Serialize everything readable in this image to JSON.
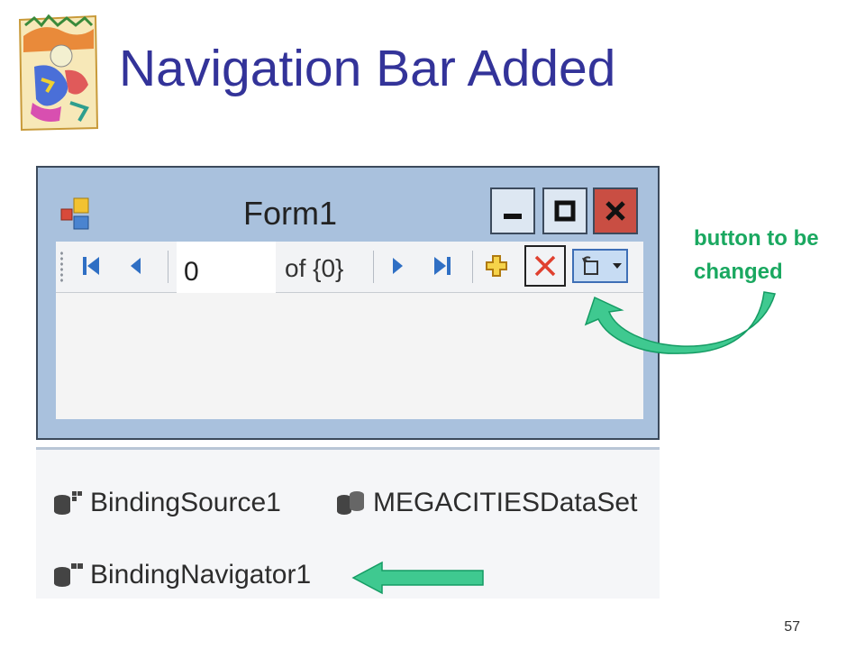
{
  "slide": {
    "title": "Navigation Bar Added",
    "page_number": "57",
    "callout": {
      "line1": "button to be",
      "line2": "changed"
    }
  },
  "form": {
    "title": "Form1",
    "window_controls": [
      "minimize-icon",
      "maximize-icon",
      "close-icon"
    ]
  },
  "navigator": {
    "position_value": "0",
    "count_label": "of {0}",
    "buttons": [
      "move-first-icon",
      "move-previous-icon",
      "move-next-icon",
      "move-last-icon",
      "add-new-icon",
      "delete-icon",
      "reset-dropdown-icon"
    ]
  },
  "component_tray": {
    "items": [
      {
        "label": "BindingSource1",
        "icon": "binding-source-icon"
      },
      {
        "label": "MEGACITIESDataSet",
        "icon": "dataset-icon"
      },
      {
        "label": "BindingNavigator1",
        "icon": "binding-navigator-icon"
      }
    ]
  },
  "colors": {
    "title": "#333399",
    "callout": "#1aa860",
    "arrow_fill": "#3fc990",
    "window_frame": "#a9c1dd",
    "close_button": "#c94e43"
  }
}
